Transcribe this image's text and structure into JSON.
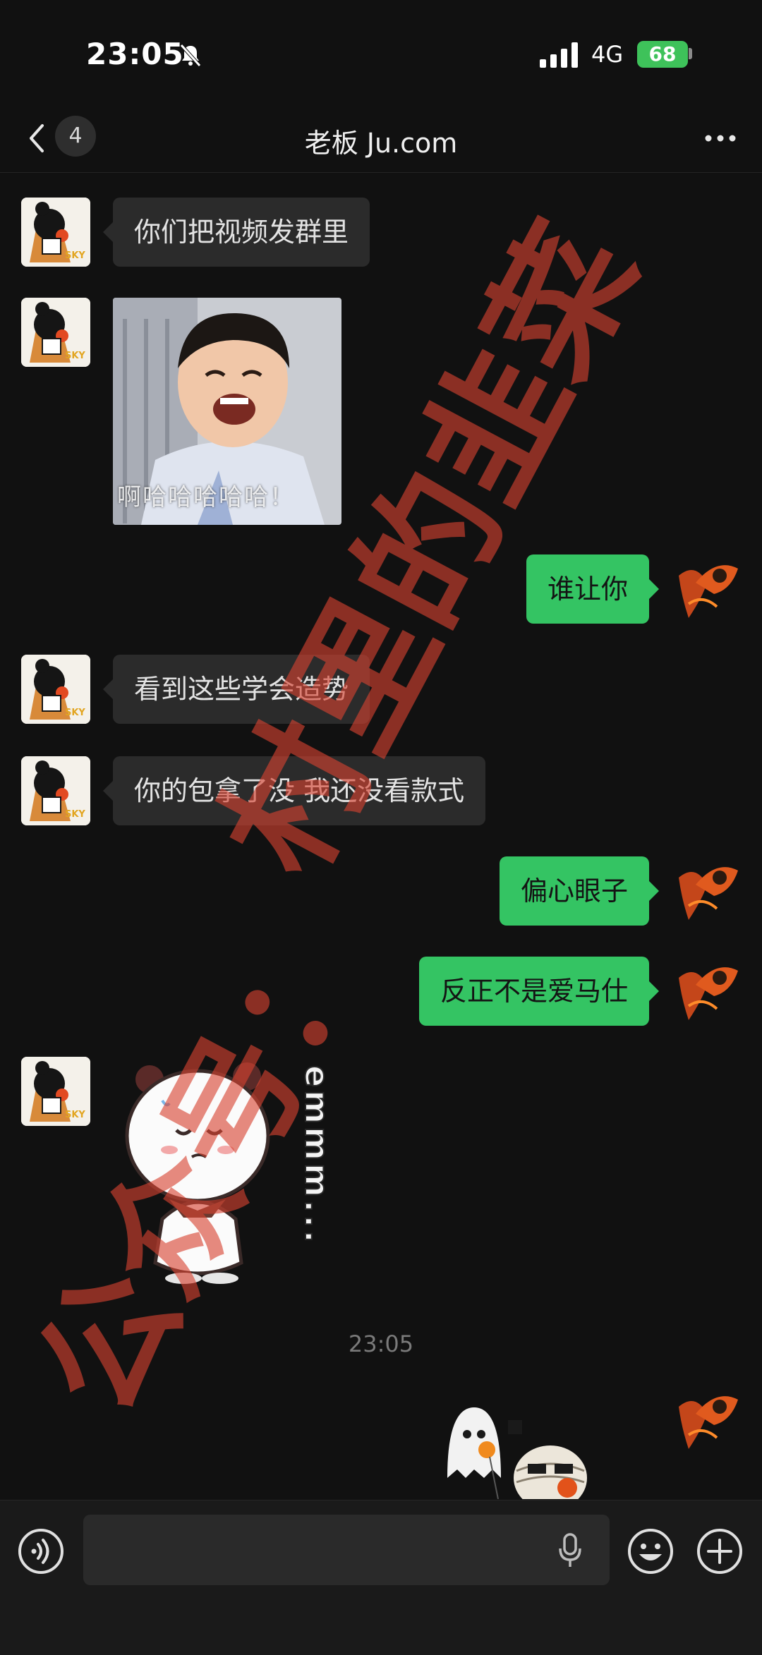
{
  "status_bar": {
    "time": "23:05",
    "network": "4G",
    "battery": "68"
  },
  "nav": {
    "unread_count": "4",
    "title": "老板 Ju.com"
  },
  "messages": [
    {
      "side": "in",
      "type": "text",
      "text": "你们把视频发群里"
    },
    {
      "side": "in",
      "type": "image",
      "caption": "啊哈哈哈哈哈！"
    },
    {
      "side": "out",
      "type": "text",
      "text": "谁让你"
    },
    {
      "side": "in",
      "type": "text",
      "text": "看到这些学会造势"
    },
    {
      "side": "in",
      "type": "text",
      "text": "你的包拿了没 我还没看款式"
    },
    {
      "side": "out",
      "type": "text",
      "text": "偏心眼子"
    },
    {
      "side": "out",
      "type": "text",
      "text": "反正不是爱马仕"
    },
    {
      "side": "in",
      "type": "sticker",
      "text": "emmm..."
    },
    {
      "side": "out",
      "type": "sticker"
    }
  ],
  "timestamp": "23:05",
  "watermark": {
    "line1": "村里的韭菜",
    "line2": "公众号："
  },
  "colors": {
    "background": "#111111",
    "incoming_bubble": "#2b2b2b",
    "outgoing_bubble": "#34c463",
    "battery": "#3ec25a",
    "watermark": "#d64230"
  }
}
